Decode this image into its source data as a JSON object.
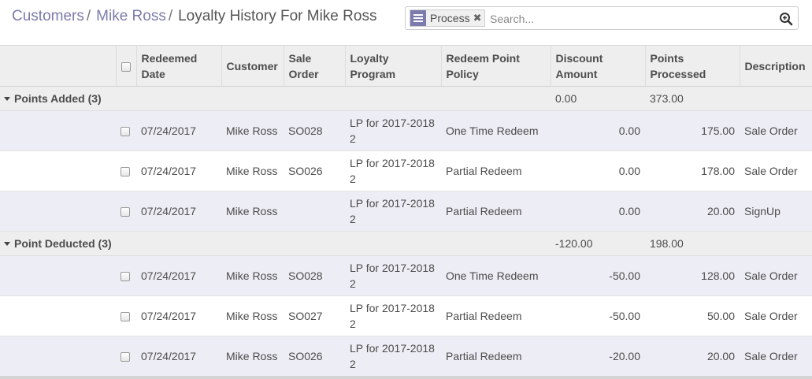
{
  "breadcrumb": {
    "items": [
      "Customers",
      "Mike Ross"
    ],
    "separator": "/",
    "current": "Loyalty History For Mike Ross"
  },
  "search": {
    "facet_label": "Process",
    "facet_icon": "list-icon",
    "placeholder": "Search...",
    "value": ""
  },
  "table": {
    "columns": [
      "Redeemed Date",
      "Customer",
      "Sale Order",
      "Loyalty Program",
      "Redeem Point Policy",
      "Discount Amount",
      "Points Processed",
      "Description"
    ],
    "groups": [
      {
        "name": "Points Added (3)",
        "discount_total": "0.00",
        "points_total": "373.00",
        "rows": [
          {
            "date": "07/24/2017",
            "customer": "Mike Ross",
            "sale_order": "SO028",
            "program": "LP for 2017-2018 2",
            "policy": "One Time Redeem",
            "discount": "0.00",
            "points": "175.00",
            "description": "Sale Order"
          },
          {
            "date": "07/24/2017",
            "customer": "Mike Ross",
            "sale_order": "SO026",
            "program": "LP for 2017-2018 2",
            "policy": "Partial Redeem",
            "discount": "0.00",
            "points": "178.00",
            "description": "Sale Order"
          },
          {
            "date": "07/24/2017",
            "customer": "Mike Ross",
            "sale_order": "",
            "program": "LP for 2017-2018 2",
            "policy": "Partial Redeem",
            "discount": "0.00",
            "points": "20.00",
            "description": "SignUp"
          }
        ]
      },
      {
        "name": "Point Deducted (3)",
        "discount_total": "-120.00",
        "points_total": "198.00",
        "rows": [
          {
            "date": "07/24/2017",
            "customer": "Mike Ross",
            "sale_order": "SO028",
            "program": "LP for 2017-2018 2",
            "policy": "One Time Redeem",
            "discount": "-50.00",
            "points": "128.00",
            "description": "Sale Order"
          },
          {
            "date": "07/24/2017",
            "customer": "Mike Ross",
            "sale_order": "SO027",
            "program": "LP for 2017-2018 2",
            "policy": "Partial Redeem",
            "discount": "-50.00",
            "points": "50.00",
            "description": "Sale Order"
          },
          {
            "date": "07/24/2017",
            "customer": "Mike Ross",
            "sale_order": "SO026",
            "program": "LP for 2017-2018 2",
            "policy": "Partial Redeem",
            "discount": "-20.00",
            "points": "20.00",
            "description": "Sale Order"
          }
        ]
      }
    ]
  },
  "colors": {
    "link": "#7c7bad",
    "header_bg": "#eeeeee",
    "odd_row_bg": "#ededf5",
    "facet_icon_bg": "#7c7bad"
  },
  "icons": {
    "search_button": "zoom-in-icon",
    "group_toggle": "caret-down-icon",
    "facet_remove": "close-icon"
  }
}
